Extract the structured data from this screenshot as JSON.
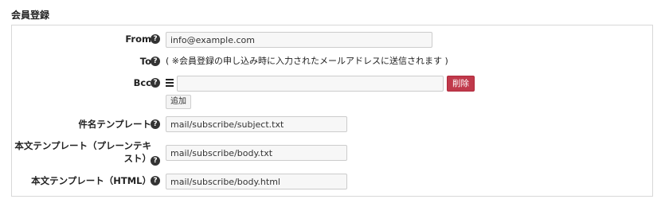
{
  "section": {
    "title": "会員登録"
  },
  "form": {
    "help_icon_glyph": "?",
    "from": {
      "label": "From",
      "value": "info@example.com"
    },
    "to": {
      "label": "To",
      "note": "( ※会員登録の申し込み時に入力されたメールアドレスに送信されます )"
    },
    "bcc": {
      "label": "Bcc",
      "value": "",
      "delete_label": "削除",
      "add_label": "追加"
    },
    "subject_template": {
      "label": "件名テンプレート",
      "value": "mail/subscribe/subject.txt"
    },
    "body_plain_template": {
      "label_line1": "本文テンプレート（プレーンテキ",
      "label_line2": "スト）",
      "value": "mail/subscribe/body.txt"
    },
    "body_html_template": {
      "label": "本文テンプレート（HTML）",
      "value": "mail/subscribe/body.html"
    }
  },
  "colors": {
    "danger": "#c0394b",
    "border": "#d8d8d8",
    "input_bg": "#f7f7f7"
  }
}
